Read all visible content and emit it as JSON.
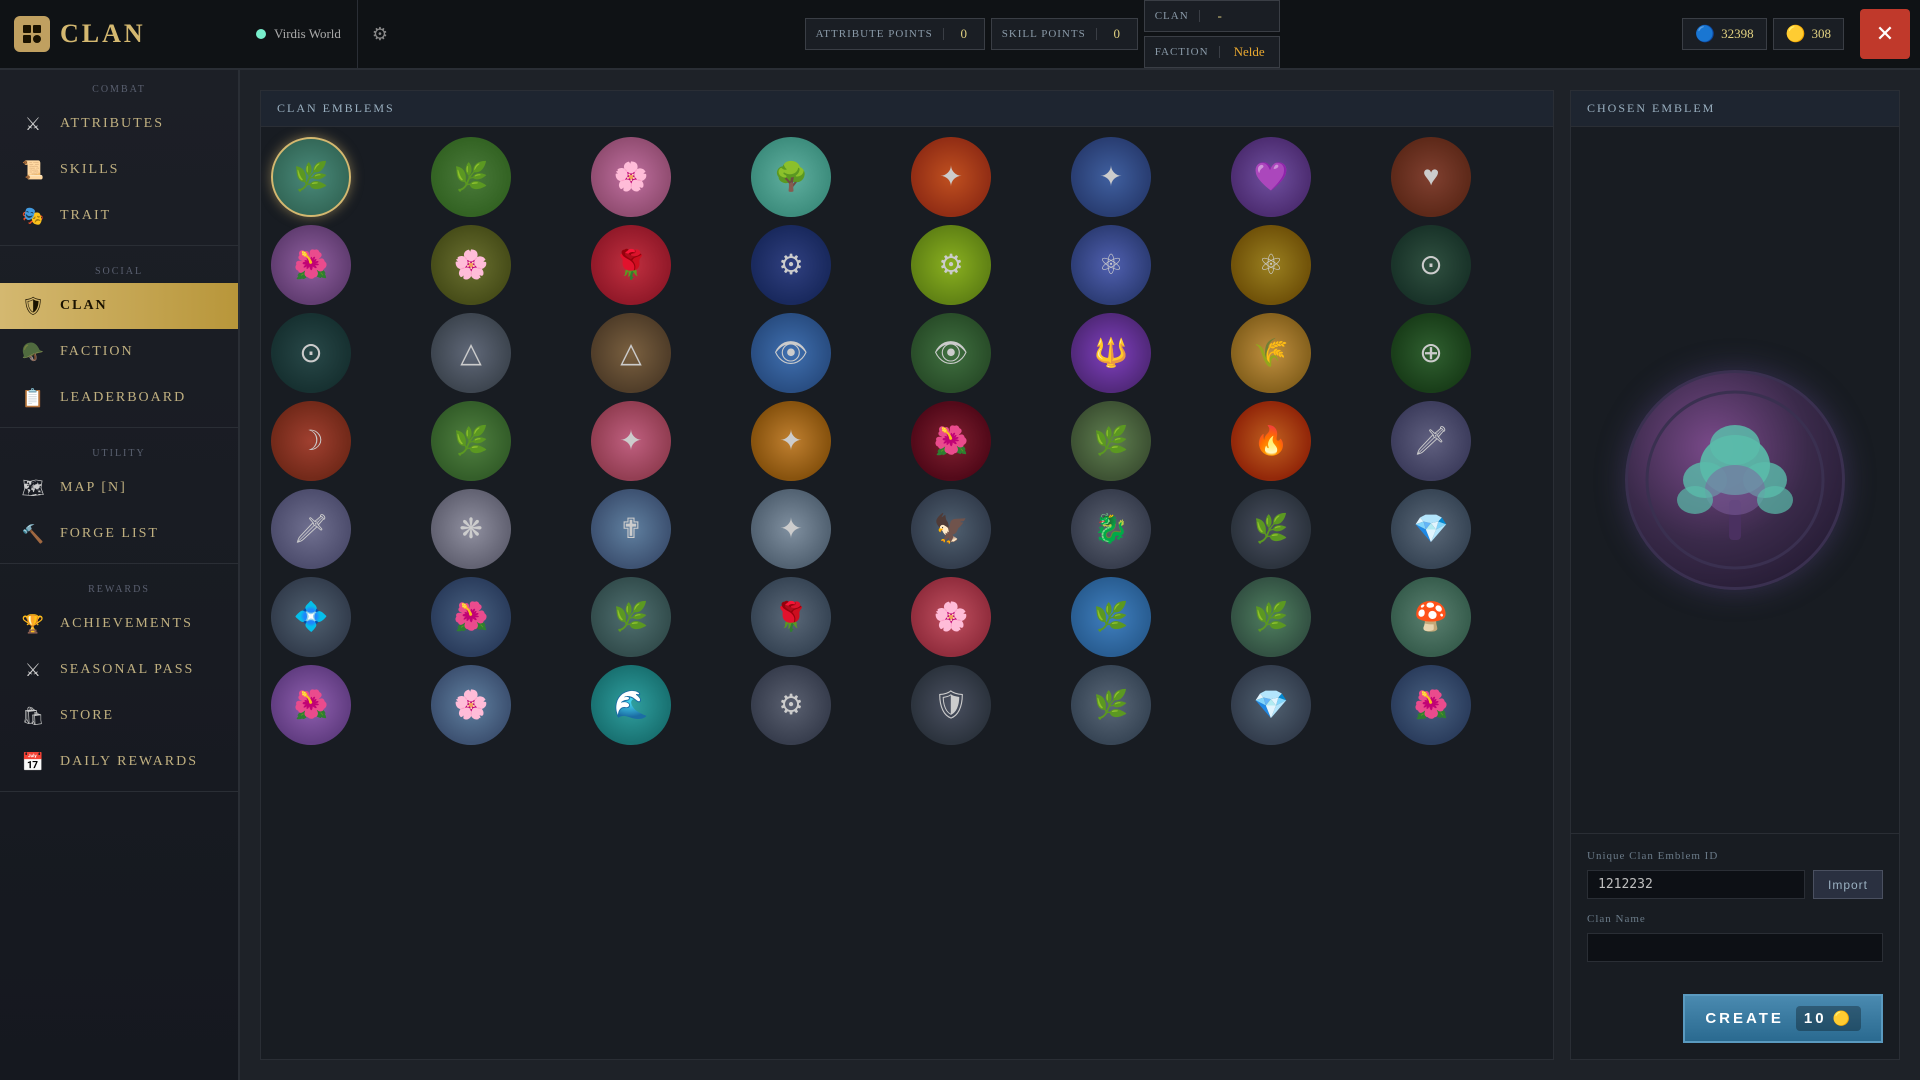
{
  "topbar": {
    "logo": "CLAN",
    "world_name": "Virdis World",
    "attribute_points_label": "ATTRIBUTE POINTS",
    "attribute_points_value": "0",
    "skill_points_label": "SKILL POINTS",
    "skill_points_value": "0",
    "clan_label": "CLAN",
    "clan_value": "-",
    "faction_label": "FACTION",
    "faction_value": "Nelde",
    "currency1_amount": "32398",
    "currency2_amount": "308",
    "close_label": "✕"
  },
  "sidebar": {
    "sections": [
      {
        "label": "COMBAT",
        "items": [
          {
            "id": "attributes",
            "label": "ATTRIBUTES",
            "icon": "⚔"
          },
          {
            "id": "skills",
            "label": "SKILLS",
            "icon": "📜"
          },
          {
            "id": "trait",
            "label": "TRAIT",
            "icon": "🎭"
          }
        ]
      },
      {
        "label": "SOCIAL",
        "items": [
          {
            "id": "clan",
            "label": "CLAN",
            "icon": "🛡",
            "active": true
          },
          {
            "id": "faction",
            "label": "FACTION",
            "icon": "🪖"
          },
          {
            "id": "leaderboard",
            "label": "LEADERBOARD",
            "icon": "📋"
          }
        ]
      },
      {
        "label": "UTILITY",
        "items": [
          {
            "id": "map",
            "label": "MAP [N]",
            "icon": "🗺"
          },
          {
            "id": "forgelist",
            "label": "FORGE LIST",
            "icon": "🔨"
          }
        ]
      },
      {
        "label": "REWARDS",
        "items": [
          {
            "id": "achievements",
            "label": "ACHIEVEMENTS",
            "icon": "🏆"
          },
          {
            "id": "seasonal",
            "label": "SEASONAL PASS",
            "icon": "⚔"
          },
          {
            "id": "store",
            "label": "STORE",
            "icon": "🛍"
          },
          {
            "id": "daily",
            "label": "DAILY REWARDS",
            "icon": "📅"
          }
        ]
      }
    ]
  },
  "emblems_panel": {
    "header": "CLAN EMBLEMS"
  },
  "chosen_panel": {
    "header": "CHOSEN EMBLEM",
    "id_label": "Unique Clan Emblem ID",
    "id_value": "1212232",
    "import_label": "Import",
    "name_label": "Clan Name",
    "name_placeholder": "",
    "create_label": "CREATE",
    "create_cost": "10"
  },
  "emblems": [
    {
      "id": 1,
      "bg": "bg-teal",
      "icon": "🌿",
      "selected": true
    },
    {
      "id": 2,
      "bg": "bg-green",
      "icon": "🌿"
    },
    {
      "id": 3,
      "bg": "bg-pink",
      "icon": "🌸"
    },
    {
      "id": 4,
      "bg": "bg-mint",
      "icon": "🌳"
    },
    {
      "id": 5,
      "bg": "bg-red-orange",
      "icon": "✦"
    },
    {
      "id": 6,
      "bg": "bg-blue-gold",
      "icon": "✦"
    },
    {
      "id": 7,
      "bg": "bg-purple",
      "icon": "💜"
    },
    {
      "id": 8,
      "bg": "bg-brown",
      "icon": "♥"
    },
    {
      "id": 9,
      "bg": "bg-mauve",
      "icon": "🌺"
    },
    {
      "id": 10,
      "bg": "bg-olive",
      "icon": "🌸"
    },
    {
      "id": 11,
      "bg": "bg-crimson",
      "icon": "🌹"
    },
    {
      "id": 12,
      "bg": "bg-dark-blue",
      "icon": "⚙"
    },
    {
      "id": 13,
      "bg": "bg-yellow-green",
      "icon": "⚙"
    },
    {
      "id": 14,
      "bg": "bg-atom",
      "icon": "⚛"
    },
    {
      "id": 15,
      "bg": "bg-gold-star",
      "icon": "⚛"
    },
    {
      "id": 16,
      "bg": "bg-dark-green",
      "icon": "⊙"
    },
    {
      "id": 17,
      "bg": "bg-dark-teal",
      "icon": "⊙"
    },
    {
      "id": 18,
      "bg": "bg-silver",
      "icon": "△"
    },
    {
      "id": 19,
      "bg": "bg-bronze",
      "icon": "△"
    },
    {
      "id": 20,
      "bg": "bg-eye-blue",
      "icon": "👁"
    },
    {
      "id": 21,
      "bg": "bg-eye-green",
      "icon": "👁"
    },
    {
      "id": 22,
      "bg": "bg-purple2",
      "icon": "🔱"
    },
    {
      "id": 23,
      "bg": "bg-gold2",
      "icon": "🌾"
    },
    {
      "id": 24,
      "bg": "bg-green2",
      "icon": "⊕"
    },
    {
      "id": 25,
      "bg": "bg-red2",
      "icon": "☽"
    },
    {
      "id": 26,
      "bg": "bg-grass",
      "icon": "🌿"
    },
    {
      "id": 27,
      "bg": "bg-pink2",
      "icon": "✦"
    },
    {
      "id": 28,
      "bg": "bg-gold3",
      "icon": "✦"
    },
    {
      "id": 29,
      "bg": "bg-dark-red",
      "icon": "🌺"
    },
    {
      "id": 30,
      "bg": "bg-leaf",
      "icon": "🌿"
    },
    {
      "id": 31,
      "bg": "bg-fire",
      "icon": "🔥"
    },
    {
      "id": 32,
      "bg": "bg-sword",
      "icon": "🗡"
    },
    {
      "id": 33,
      "bg": "bg-sword2",
      "icon": "🗡"
    },
    {
      "id": 34,
      "bg": "bg-white-flower",
      "icon": "❋"
    },
    {
      "id": 35,
      "bg": "bg-cross",
      "icon": "✟"
    },
    {
      "id": 36,
      "bg": "bg-star2",
      "icon": "✦"
    },
    {
      "id": 37,
      "bg": "bg-bird",
      "icon": "🦅"
    },
    {
      "id": 38,
      "bg": "bg-gray1",
      "icon": "🐉"
    },
    {
      "id": 39,
      "bg": "bg-gray2",
      "icon": "🌿"
    },
    {
      "id": 40,
      "bg": "bg-gray3",
      "icon": "💎"
    },
    {
      "id": 41,
      "bg": "bg-gray4",
      "icon": "💠"
    },
    {
      "id": 42,
      "bg": "bg-gray5",
      "icon": "🌺"
    },
    {
      "id": 43,
      "bg": "bg-gray6",
      "icon": "🌿"
    },
    {
      "id": 44,
      "bg": "bg-gray7",
      "icon": "🌹"
    },
    {
      "id": 45,
      "bg": "bg-gray8",
      "icon": "🌸"
    },
    {
      "id": 46,
      "bg": "bg-blue2",
      "icon": "🌿"
    },
    {
      "id": 47,
      "bg": "bg-multigreen",
      "icon": "🌿"
    },
    {
      "id": 48,
      "bg": "bg-multi2",
      "icon": "🍄"
    },
    {
      "id": 49,
      "bg": "bg-purple3",
      "icon": "🌺"
    },
    {
      "id": 50,
      "bg": "bg-flower2",
      "icon": "🌸"
    },
    {
      "id": 51,
      "bg": "bg-teal2",
      "icon": "🌊"
    },
    {
      "id": 52,
      "bg": "bg-gray1",
      "icon": "⚙"
    },
    {
      "id": 53,
      "bg": "bg-gray2",
      "icon": "🛡"
    },
    {
      "id": 54,
      "bg": "bg-gray3",
      "icon": "🌿"
    },
    {
      "id": 55,
      "bg": "bg-gray4",
      "icon": "💎"
    },
    {
      "id": 56,
      "bg": "bg-gray5",
      "icon": "🌺"
    }
  ]
}
